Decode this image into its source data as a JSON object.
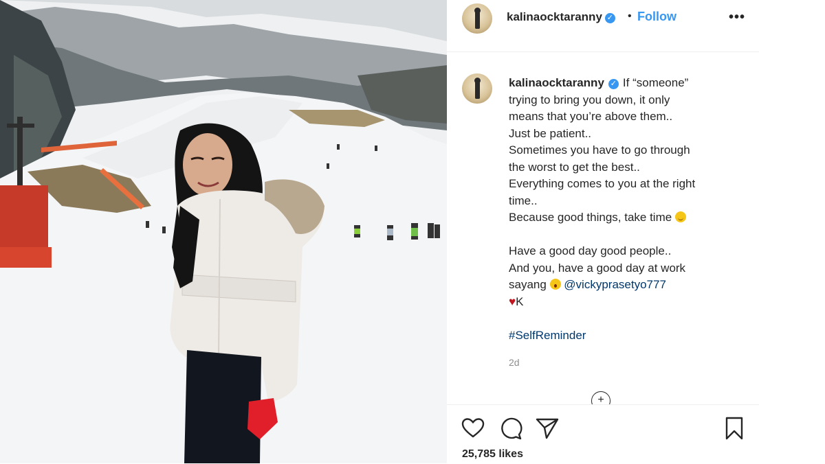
{
  "post": {
    "image_alt": "Woman in white puffer jacket on ski slope",
    "header": {
      "username": "kalinaocktaranny",
      "verified_icon": "verified-badge-icon",
      "separator": "•",
      "follow_label": "Follow",
      "more_label": "•••"
    },
    "caption": {
      "username": "kalinaocktaranny",
      "lines": [
        "If “someone”",
        "trying to bring you down, it only",
        "means that you’re above them..",
        "Just be patient..",
        "Sometimes you have to go through",
        "the worst to get the best..",
        "Everything comes to you at the right",
        "time..",
        "Because good things, take time"
      ],
      "line10": "Have a good day good people..",
      "line11": "And you, have a good day at work",
      "line12_prefix": "sayang",
      "mention": "@vickyprasetyo777",
      "sign_heart": "♥",
      "sign_name": "K",
      "hashtag": "#SelfReminder"
    },
    "timestamp": "2d",
    "likes": "25,785 likes",
    "colors": {
      "accent": "#3897f0",
      "link": "#00376b",
      "text": "#262626",
      "muted": "#8e8e8e"
    },
    "icons": [
      "heart-icon",
      "comment-icon",
      "share-icon",
      "bookmark-icon",
      "more-icon",
      "verified-badge-icon",
      "load-more-comments-icon"
    ]
  }
}
